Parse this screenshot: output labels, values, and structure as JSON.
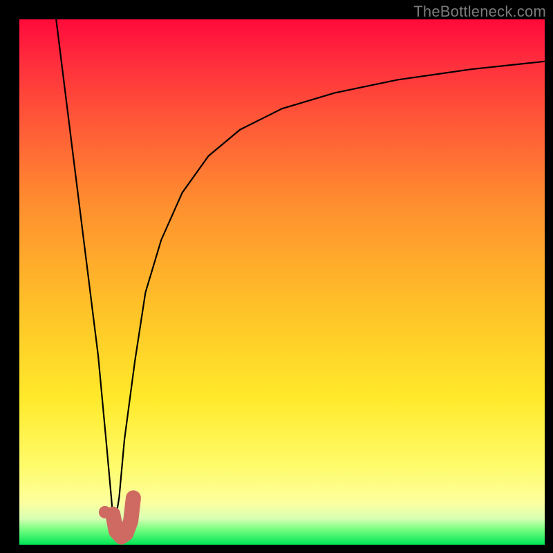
{
  "watermark": "TheBottleneck.com",
  "chart_data": {
    "type": "line",
    "title": "",
    "xlabel": "",
    "ylabel": "",
    "xlim": [
      0,
      100
    ],
    "ylim": [
      0,
      100
    ],
    "grid": false,
    "legend": false,
    "series": [
      {
        "name": "left-branch",
        "x": [
          7,
          9,
          11,
          13,
          15,
          16.5,
          17.5,
          18
        ],
        "y": [
          100,
          84,
          68,
          52,
          36,
          20,
          9,
          3
        ]
      },
      {
        "name": "right-branch",
        "x": [
          18,
          19,
          20,
          22,
          24,
          27,
          31,
          36,
          42,
          50,
          60,
          72,
          86,
          100
        ],
        "y": [
          3,
          9,
          20,
          35,
          48,
          58,
          67,
          74,
          79,
          83,
          86,
          88.5,
          90.5,
          92
        ]
      }
    ],
    "marker": {
      "hook": {
        "x": [
          17.8,
          18.4,
          19.4,
          20.3,
          21.2,
          21.7
        ],
        "y": [
          5.8,
          2.6,
          1.5,
          2.1,
          4.5,
          8.9
        ]
      },
      "dot": {
        "x": 16.3,
        "y": 6.2
      }
    },
    "background_bands": [
      {
        "color": "#ff0a3a",
        "pos": 0
      },
      {
        "color": "#ffe92a",
        "pos": 72
      },
      {
        "color": "#00e556",
        "pos": 100
      }
    ]
  }
}
